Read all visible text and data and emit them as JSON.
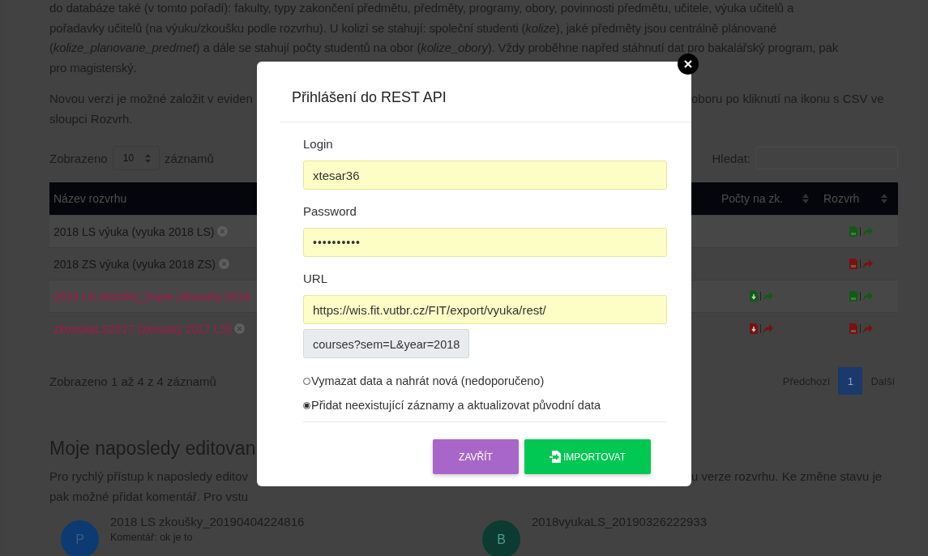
{
  "intro": {
    "lines": [
      "do databáze také (v tomto pořadí): fakulty, typy zakončení předmětu, předměty, programy, obory, povinnosti předmětu, učitele, výuka učitelů a",
      "pořadavky učitelů (na výuku/zkoušku podle rozvrhu). U kolizí se stahují: společní studenti (*kolize*), jaké předměty jsou centrálně plánované",
      "(*kolize_planovane_predmet*) a dále se stahují počty studentů na obor (*kolize_obory*). Vždy proběhne napřed stáhnutí dat pro bakalářský program, pak",
      "pro magisterský."
    ]
  },
  "note": {
    "left_lines": [
      "Novou verzi je možné založit v eviden",
      "sloupci Rozvrh."
    ],
    "right_lines": [
      "oboru po kliknutí na ikonu s CSV ve"
    ]
  },
  "length_menu": {
    "label_before": "Zobrazeno",
    "value": "10",
    "label_after": "záznamů"
  },
  "search": {
    "label": "Hledat:"
  },
  "table": {
    "columns": [
      "Název rozvrhu",
      "Počty na zk.",
      "Rozvrh"
    ],
    "rows": [
      {
        "name": "2018 LS výuka (vyuka 2018 LS)",
        "color": "#161616",
        "remove_icon": true,
        "schedule": {
          "color": "#0f5c14"
        }
      },
      {
        "name": "2018 ZS výuka (vyuka 2018 ZS)",
        "color": "#161616",
        "remove_icon": true,
        "schedule": {
          "color": "#7a1010"
        }
      },
      {
        "name": "2018 LS zkoušky_kopie (zkousky 2018",
        "color": "#a8164a",
        "remove_icon": false,
        "counts": {
          "color": "#0f5c14"
        },
        "schedule": {
          "color": "#0f5c14"
        }
      },
      {
        "name": "zkouskaLS2017 (zkousky 2017 LS)",
        "color": "#a8164a",
        "remove_icon": true,
        "counts": {
          "color": "#7a1010"
        },
        "schedule": {
          "color": "#7a1010"
        }
      }
    ]
  },
  "info": "Zobrazeno 1 až 4 z 4 záznamů",
  "pagination": {
    "prev": "Předchozí",
    "pages": [
      {
        "label": "1",
        "selected": true
      }
    ],
    "next": "Další"
  },
  "recent": {
    "title": "Moje naposledy editovan",
    "left_lines": [
      "Pro rychlý přístup k naposledy editov",
      "pak možné přidat komentář. Pro vstu"
    ],
    "right_lines": [
      "u verze rozvrhu. Ke změne stavu je"
    ],
    "items": [
      {
        "initial": "P",
        "color": "#0d3a72",
        "title": "2018 LS zkoušky_20190404224816",
        "comment": "Komentář: ok je to"
      },
      {
        "initial": "B",
        "color": "#0b3b31",
        "title": "2018vyukaLS_20190326222933"
      }
    ]
  },
  "dialog": {
    "title": "Přihlášení do REST API",
    "fields": [
      {
        "label": "Login",
        "value": "xtesar36",
        "kind": "text"
      },
      {
        "label": "Password",
        "value": "••••••••••",
        "kind": "password"
      },
      {
        "label": "URL",
        "value": "https://wis.fit.vutbr.cz/FIT/export/vyuka/rest/",
        "kind": "text",
        "addon": "courses?sem=L&year=2018"
      }
    ],
    "options": [
      {
        "label": "Vymazat data a nahrát nová (nedoporučeno)",
        "selected": false
      },
      {
        "label": "Přidat neexistující záznamy a aktualizovat původní data",
        "selected": true
      }
    ],
    "buttons": [
      {
        "label": "ZAVŘÍT",
        "kind": "close"
      },
      {
        "label": "IMPORTOVAT",
        "kind": "import"
      }
    ]
  }
}
